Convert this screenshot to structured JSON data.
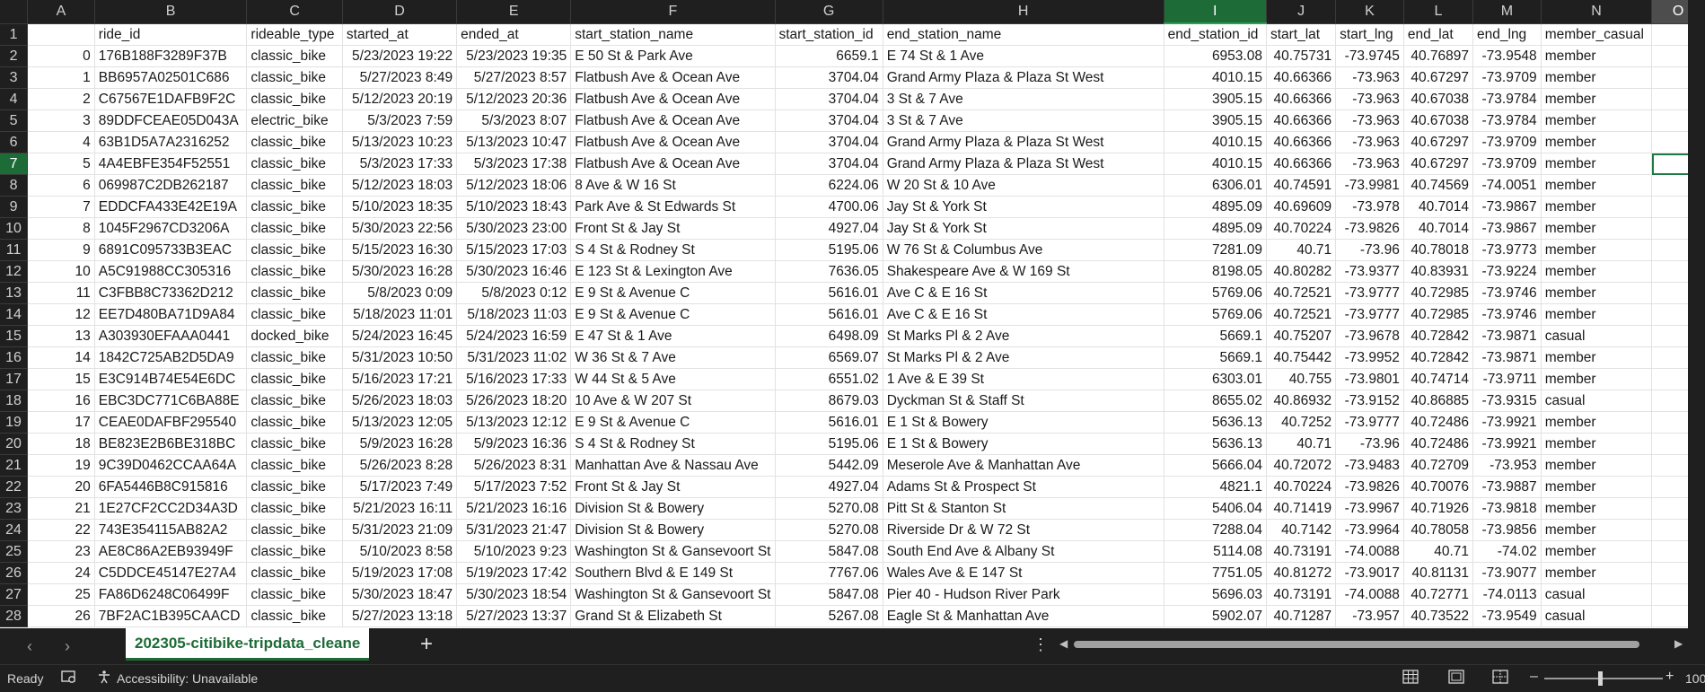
{
  "columns": [
    {
      "letter": "A",
      "width": 113
    },
    {
      "letter": "B",
      "width": 172
    },
    {
      "letter": "C",
      "width": 110
    },
    {
      "letter": "D",
      "width": 132
    },
    {
      "letter": "E",
      "width": 132
    },
    {
      "letter": "F",
      "width": 80
    },
    {
      "letter": "G",
      "width": 125
    },
    {
      "letter": "H",
      "width": 362
    },
    {
      "letter": "I",
      "width": 118
    },
    {
      "letter": "J",
      "width": 80
    },
    {
      "letter": "K",
      "width": 80
    },
    {
      "letter": "L",
      "width": 80
    },
    {
      "letter": "M",
      "width": 80
    },
    {
      "letter": "N",
      "width": 127
    },
    {
      "letter": "O",
      "width": 88
    }
  ],
  "selected_column": "I",
  "active_cell": {
    "row": 7,
    "col": "O"
  },
  "headers": [
    "",
    "ride_id",
    "rideable_type",
    "started_at",
    "ended_at",
    "start_station_name",
    "start_station_id",
    "end_station_name",
    "end_station_id",
    "start_lat",
    "start_lng",
    "end_lat",
    "end_lng",
    "member_casual",
    ""
  ],
  "rows": [
    [
      "0",
      "176B188F3289F37B",
      "classic_bike",
      "5/23/2023 19:22",
      "5/23/2023 19:35",
      "E 50 St & Park Ave",
      "6659.1",
      "E 74 St & 1 Ave",
      "6953.08",
      "40.75731",
      "-73.9745",
      "40.76897",
      "-73.9548",
      "member"
    ],
    [
      "1",
      "BB6957A02501C686",
      "classic_bike",
      "5/27/2023 8:49",
      "5/27/2023 8:57",
      "Flatbush Ave & Ocean Ave",
      "3704.04",
      "Grand Army Plaza & Plaza St West",
      "4010.15",
      "40.66366",
      "-73.963",
      "40.67297",
      "-73.9709",
      "member"
    ],
    [
      "2",
      "C67567E1DAFB9F2C",
      "classic_bike",
      "5/12/2023 20:19",
      "5/12/2023 20:36",
      "Flatbush Ave & Ocean Ave",
      "3704.04",
      "3 St & 7 Ave",
      "3905.15",
      "40.66366",
      "-73.963",
      "40.67038",
      "-73.9784",
      "member"
    ],
    [
      "3",
      "89DDFCEAE05D043A",
      "electric_bike",
      "5/3/2023 7:59",
      "5/3/2023 8:07",
      "Flatbush Ave & Ocean Ave",
      "3704.04",
      "3 St & 7 Ave",
      "3905.15",
      "40.66366",
      "-73.963",
      "40.67038",
      "-73.9784",
      "member"
    ],
    [
      "4",
      "63B1D5A7A2316252",
      "classic_bike",
      "5/13/2023 10:23",
      "5/13/2023 10:47",
      "Flatbush Ave & Ocean Ave",
      "3704.04",
      "Grand Army Plaza & Plaza St West",
      "4010.15",
      "40.66366",
      "-73.963",
      "40.67297",
      "-73.9709",
      "member"
    ],
    [
      "5",
      "4A4EBFE354F52551",
      "classic_bike",
      "5/3/2023 17:33",
      "5/3/2023 17:38",
      "Flatbush Ave & Ocean Ave",
      "3704.04",
      "Grand Army Plaza & Plaza St West",
      "4010.15",
      "40.66366",
      "-73.963",
      "40.67297",
      "-73.9709",
      "member"
    ],
    [
      "6",
      "069987C2DB262187",
      "classic_bike",
      "5/12/2023 18:03",
      "5/12/2023 18:06",
      "8 Ave & W 16 St",
      "6224.06",
      "W 20 St & 10 Ave",
      "6306.01",
      "40.74591",
      "-73.9981",
      "40.74569",
      "-74.0051",
      "member"
    ],
    [
      "7",
      "EDDCFA433E42E19A",
      "classic_bike",
      "5/10/2023 18:35",
      "5/10/2023 18:43",
      "Park Ave & St Edwards St",
      "4700.06",
      "Jay St & York St",
      "4895.09",
      "40.69609",
      "-73.978",
      "40.7014",
      "-73.9867",
      "member"
    ],
    [
      "8",
      "1045F2967CD3206A",
      "classic_bike",
      "5/30/2023 22:56",
      "5/30/2023 23:00",
      "Front St & Jay St",
      "4927.04",
      "Jay St & York St",
      "4895.09",
      "40.70224",
      "-73.9826",
      "40.7014",
      "-73.9867",
      "member"
    ],
    [
      "9",
      "6891C095733B3EAC",
      "classic_bike",
      "5/15/2023 16:30",
      "5/15/2023 17:03",
      "S 4 St & Rodney St",
      "5195.06",
      "W 76 St & Columbus Ave",
      "7281.09",
      "40.71",
      "-73.96",
      "40.78018",
      "-73.9773",
      "member"
    ],
    [
      "10",
      "A5C91988CC305316",
      "classic_bike",
      "5/30/2023 16:28",
      "5/30/2023 16:46",
      "E 123 St & Lexington Ave",
      "7636.05",
      "Shakespeare Ave & W 169 St",
      "8198.05",
      "40.80282",
      "-73.9377",
      "40.83931",
      "-73.9224",
      "member"
    ],
    [
      "11",
      "C3FBB8C73362D212",
      "classic_bike",
      "5/8/2023 0:09",
      "5/8/2023 0:12",
      "E 9 St & Avenue C",
      "5616.01",
      "Ave C & E 16 St",
      "5769.06",
      "40.72521",
      "-73.9777",
      "40.72985",
      "-73.9746",
      "member"
    ],
    [
      "12",
      "EE7D480BA71D9A84",
      "classic_bike",
      "5/18/2023 11:01",
      "5/18/2023 11:03",
      "E 9 St & Avenue C",
      "5616.01",
      "Ave C & E 16 St",
      "5769.06",
      "40.72521",
      "-73.9777",
      "40.72985",
      "-73.9746",
      "member"
    ],
    [
      "13",
      "A303930EFAAA0441",
      "docked_bike",
      "5/24/2023 16:45",
      "5/24/2023 16:59",
      "E 47 St & 1 Ave",
      "6498.09",
      "St Marks Pl & 2 Ave",
      "5669.1",
      "40.75207",
      "-73.9678",
      "40.72842",
      "-73.9871",
      "casual"
    ],
    [
      "14",
      "1842C725AB2D5DA9",
      "classic_bike",
      "5/31/2023 10:50",
      "5/31/2023 11:02",
      "W 36 St & 7 Ave",
      "6569.07",
      "St Marks Pl & 2 Ave",
      "5669.1",
      "40.75442",
      "-73.9952",
      "40.72842",
      "-73.9871",
      "member"
    ],
    [
      "15",
      "E3C914B74E54E6DC",
      "classic_bike",
      "5/16/2023 17:21",
      "5/16/2023 17:33",
      "W 44 St & 5 Ave",
      "6551.02",
      "1 Ave & E 39 St",
      "6303.01",
      "40.755",
      "-73.9801",
      "40.74714",
      "-73.9711",
      "member"
    ],
    [
      "16",
      "EBC3DC771C6BA88E",
      "classic_bike",
      "5/26/2023 18:03",
      "5/26/2023 18:20",
      "10 Ave & W 207 St",
      "8679.03",
      "Dyckman St & Staff St",
      "8655.02",
      "40.86932",
      "-73.9152",
      "40.86885",
      "-73.9315",
      "casual"
    ],
    [
      "17",
      "CEAE0DAFBF295540",
      "classic_bike",
      "5/13/2023 12:05",
      "5/13/2023 12:12",
      "E 9 St & Avenue C",
      "5616.01",
      "E 1 St & Bowery",
      "5636.13",
      "40.7252",
      "-73.9777",
      "40.72486",
      "-73.9921",
      "member"
    ],
    [
      "18",
      "BE823E2B6BE318BC",
      "classic_bike",
      "5/9/2023 16:28",
      "5/9/2023 16:36",
      "S 4 St & Rodney St",
      "5195.06",
      "E 1 St & Bowery",
      "5636.13",
      "40.71",
      "-73.96",
      "40.72486",
      "-73.9921",
      "member"
    ],
    [
      "19",
      "9C39D0462CCAA64A",
      "classic_bike",
      "5/26/2023 8:28",
      "5/26/2023 8:31",
      "Manhattan Ave & Nassau Ave",
      "5442.09",
      "Meserole Ave & Manhattan Ave",
      "5666.04",
      "40.72072",
      "-73.9483",
      "40.72709",
      "-73.953",
      "member"
    ],
    [
      "20",
      "6FA5446B8C915816",
      "classic_bike",
      "5/17/2023 7:49",
      "5/17/2023 7:52",
      "Front St & Jay St",
      "4927.04",
      "Adams St & Prospect St",
      "4821.1",
      "40.70224",
      "-73.9826",
      "40.70076",
      "-73.9887",
      "member"
    ],
    [
      "21",
      "1E27CF2CC2D34A3D",
      "classic_bike",
      "5/21/2023 16:11",
      "5/21/2023 16:16",
      "Division St & Bowery",
      "5270.08",
      "Pitt St & Stanton St",
      "5406.04",
      "40.71419",
      "-73.9967",
      "40.71926",
      "-73.9818",
      "member"
    ],
    [
      "22",
      "743E354115AB82A2",
      "classic_bike",
      "5/31/2023 21:09",
      "5/31/2023 21:47",
      "Division St & Bowery",
      "5270.08",
      "Riverside Dr & W 72 St",
      "7288.04",
      "40.7142",
      "-73.9964",
      "40.78058",
      "-73.9856",
      "member"
    ],
    [
      "23",
      "AE8C86A2EB93949F",
      "classic_bike",
      "5/10/2023 8:58",
      "5/10/2023 9:23",
      "Washington St & Gansevoort St",
      "5847.08",
      "South End Ave & Albany St",
      "5114.08",
      "40.73191",
      "-74.0088",
      "40.71",
      "-74.02",
      "member"
    ],
    [
      "24",
      "C5DDCE45147E27A4",
      "classic_bike",
      "5/19/2023 17:08",
      "5/19/2023 17:42",
      "Southern Blvd & E 149 St",
      "7767.06",
      "Wales Ave & E 147 St",
      "7751.05",
      "40.81272",
      "-73.9017",
      "40.81131",
      "-73.9077",
      "member"
    ],
    [
      "25",
      "FA86D6248C06499F",
      "classic_bike",
      "5/30/2023 18:47",
      "5/30/2023 18:54",
      "Washington St & Gansevoort St",
      "5847.08",
      "Pier 40 - Hudson River Park",
      "5696.03",
      "40.73191",
      "-74.0088",
      "40.72771",
      "-74.0113",
      "casual"
    ],
    [
      "26",
      "7BF2AC1B395CAACD",
      "classic_bike",
      "5/27/2023 13:18",
      "5/27/2023 13:37",
      "Grand St & Elizabeth St",
      "5267.08",
      "Eagle St & Manhattan Ave",
      "5902.07",
      "40.71287",
      "-73.957",
      "40.73522",
      "-73.9549",
      "casual"
    ]
  ],
  "numeric_columns": [
    "A",
    "G",
    "I",
    "J",
    "K",
    "L",
    "M"
  ],
  "right_aligned_columns": [
    "A",
    "D",
    "E",
    "G",
    "I",
    "J",
    "K",
    "L",
    "M"
  ],
  "sheet_tab": {
    "label": "202305-citibike-tripdata_cleane"
  },
  "status": {
    "ready": "Ready",
    "accessibility": "Accessibility: Unavailable",
    "zoom": "100"
  },
  "colors": {
    "accent": "#1d6b36",
    "header_bg": "#1f1f1f",
    "selection": "#1e7a44"
  }
}
